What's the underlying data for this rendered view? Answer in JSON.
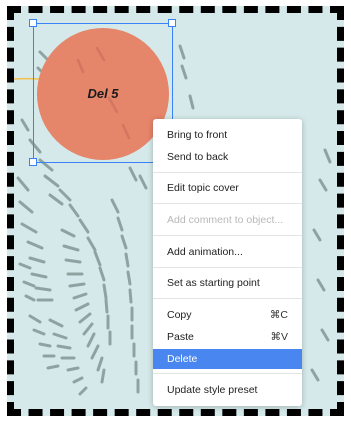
{
  "canvas": {
    "background": "#d5e9ea",
    "border_color": "#000000",
    "stroke_color": "#8ea3a1",
    "connector_color": "#f2c14e"
  },
  "topic": {
    "label": "Del 5",
    "fill": "#e5856a",
    "selection_color": "#3b82f6"
  },
  "context_menu": {
    "highlight_color": "#4a86f0",
    "items": [
      {
        "label": "Bring to front",
        "shortcut": "",
        "disabled": false,
        "highlighted": false
      },
      {
        "label": "Send to back",
        "shortcut": "",
        "disabled": false,
        "highlighted": false
      },
      {
        "label": "Edit topic cover",
        "shortcut": "",
        "disabled": false,
        "highlighted": false
      },
      {
        "label": "Add comment to object...",
        "shortcut": "",
        "disabled": true,
        "highlighted": false
      },
      {
        "label": "Add animation...",
        "shortcut": "",
        "disabled": false,
        "highlighted": false
      },
      {
        "label": "Set as starting point",
        "shortcut": "",
        "disabled": false,
        "highlighted": false
      },
      {
        "label": "Copy",
        "shortcut": "⌘C",
        "disabled": false,
        "highlighted": false
      },
      {
        "label": "Paste",
        "shortcut": "⌘V",
        "disabled": false,
        "highlighted": false
      },
      {
        "label": "Delete",
        "shortcut": "",
        "disabled": false,
        "highlighted": true
      },
      {
        "label": "Update style preset",
        "shortcut": "",
        "disabled": false,
        "highlighted": false
      }
    ]
  }
}
